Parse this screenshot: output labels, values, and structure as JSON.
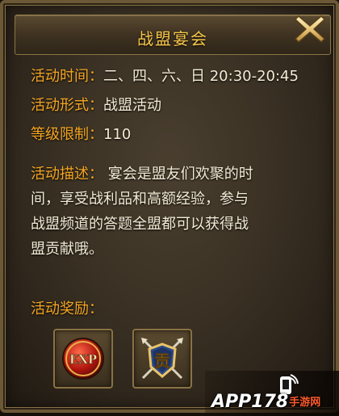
{
  "dialog": {
    "title": "战盟宴会"
  },
  "info": {
    "time_label": "活动时间：",
    "time_value": "二、四、六、日 20:30-20:45",
    "form_label": "活动形式：",
    "form_value": "战盟活动",
    "level_label": "等级限制：",
    "level_value": "110",
    "desc_label": "活动描述：",
    "desc_line1": "宴会是盟友们欢聚的时",
    "desc_line2": "间，享受战利品和高额经验，参与",
    "desc_line3": "战盟频道的答题全盟都可以获得战",
    "desc_line4": "盟贡献哦。"
  },
  "rewards": {
    "label": "活动奖励：",
    "items": [
      {
        "icon": "exp-icon",
        "text": "EXP"
      },
      {
        "icon": "contribution-icon",
        "text": "贡"
      }
    ]
  },
  "watermark": {
    "text": "APP178",
    "suffix": "手游网"
  },
  "colors": {
    "label": "#f5a623",
    "value": "#f4ecd6",
    "title": "#f7c64a",
    "frame": "#6b5836"
  }
}
